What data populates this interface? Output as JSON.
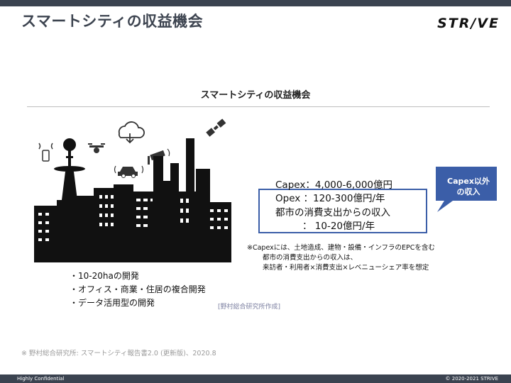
{
  "header": {
    "title": "スマートシティの収益機会",
    "logo": "STR/VE"
  },
  "section": {
    "title": "スマートシティの収益機会"
  },
  "revenue": {
    "lines": [
      "Capex：4,000-6,000億円",
      "Opex ：120-300億円/年",
      "都市の消費支出からの収入",
      "：  10-20億円/年"
    ]
  },
  "callout": {
    "line1": "Capex以外",
    "line2": "の収入",
    "color": "#3b5ea8"
  },
  "note": {
    "lines": [
      "※Capexには、土地造成、建物・設備・インフラのEPCを含む",
      "都市の消費支出からの収入は、",
      "来訪者・利用者×消費支出×レベニューシェア率を想定"
    ]
  },
  "bullets": [
    "・10-20haの開発",
    "・オフィス・商業・住居の複合開発",
    "・データ活用型の開発"
  ],
  "source_tag": "[野村総合研究所作成]",
  "footnote": "※ 野村総合研究所: スマートシティ報告書2.0 (更新版)、2020.8",
  "footer": {
    "confidential": "Highly Confidential",
    "copyright": "© 2020-2021 STRIVE"
  }
}
